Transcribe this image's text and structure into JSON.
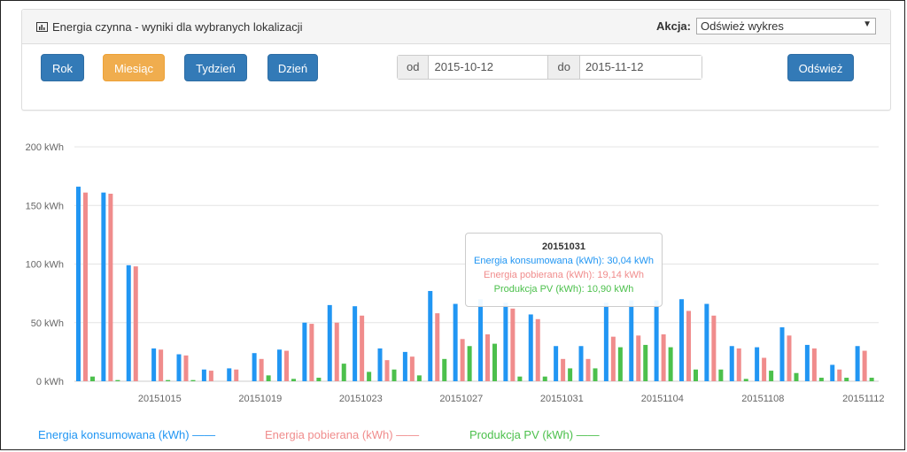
{
  "panel": {
    "title": "Energia czynna - wyniki dla wybranych lokalizacji",
    "akcja_label": "Akcja:",
    "akcja_selected": "Odśwież wykres"
  },
  "buttons": {
    "rok": "Rok",
    "miesiac": "Miesiąc",
    "tydzien": "Tydzień",
    "dzien": "Dzień",
    "odswiez": "Odśwież"
  },
  "dates": {
    "od_label": "od",
    "od_value": "2015-10-12",
    "do_label": "do",
    "do_value": "2015-11-12"
  },
  "colors": {
    "series1": "#2196f3",
    "series2": "#f08c8c",
    "series3": "#4cc04c"
  },
  "tooltip": {
    "title": "20151031",
    "line1": "Energia konsumowana (kWh): 30,04 kWh",
    "line2": "Energia pobierana (kWh): 19,14 kWh",
    "line3": "Produkcja PV (kWh): 10,90 kWh"
  },
  "legend": {
    "s1": "Energia konsumowana (kWh) ——",
    "s2": "Energia pobierana (kWh) ——",
    "s3": "Produkcja PV (kWh) ——"
  },
  "chart_data": {
    "type": "bar",
    "ylim": [
      0,
      200
    ],
    "yticks": [
      0,
      50,
      100,
      150,
      200
    ],
    "ytick_labels": [
      "0 kWh",
      "50 kWh",
      "100 kWh",
      "150 kWh",
      "200 kWh"
    ],
    "xtick_labels": [
      "20151015",
      "20151019",
      "20151023",
      "20151027",
      "20151031",
      "20151104",
      "20151108",
      "20151112"
    ],
    "grid": true,
    "series": [
      {
        "name": "Energia konsumowana (kWh)",
        "values": [
          166,
          161,
          99,
          28,
          23,
          10,
          11,
          24,
          27,
          50,
          65,
          64,
          28,
          25,
          77,
          66,
          70,
          67,
          57,
          30,
          30,
          67,
          69,
          69,
          70,
          66,
          30,
          29,
          46,
          31,
          14,
          30
        ]
      },
      {
        "name": "Energia pobierana (kWh)",
        "values": [
          161,
          160,
          98,
          27,
          22,
          9,
          10,
          19,
          26,
          49,
          50,
          56,
          18,
          21,
          58,
          36,
          40,
          62,
          53,
          19,
          19,
          38,
          39,
          40,
          60,
          56,
          28,
          20,
          39,
          28,
          10,
          26
        ]
      },
      {
        "name": "Produkcja PV (kWh)",
        "values": [
          4,
          1,
          0,
          1,
          1,
          0,
          0,
          5,
          2,
          3,
          15,
          8,
          10,
          5,
          19,
          30,
          32,
          4,
          4,
          11,
          11,
          29,
          31,
          29,
          10,
          10,
          2,
          9,
          7,
          3,
          3,
          3
        ]
      }
    ]
  }
}
